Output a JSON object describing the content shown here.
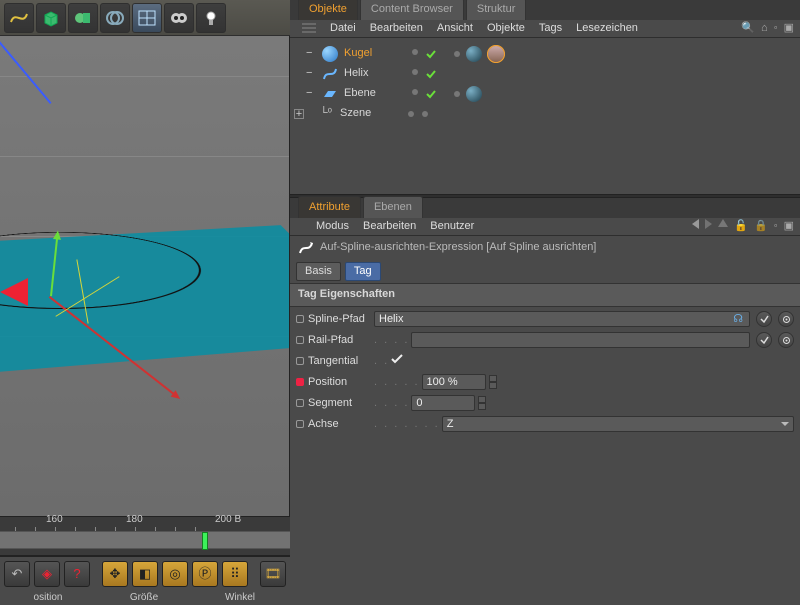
{
  "toolbar_icons": [
    "spline-icon",
    "cube-icon",
    "primitive-icon",
    "boole-icon",
    "plane-icon",
    "camera-icon",
    "light-icon"
  ],
  "object_tabs": {
    "objekte": "Objekte",
    "content_browser": "Content Browser",
    "struktur": "Struktur"
  },
  "object_menu": [
    "Datei",
    "Bearbeiten",
    "Ansicht",
    "Objekte",
    "Tags",
    "Lesezeichen"
  ],
  "hierarchy": [
    {
      "name": "Kugel",
      "type": "sphere",
      "selected": true,
      "tags": 2,
      "tagshape": "align",
      "checks": true
    },
    {
      "name": "Helix",
      "type": "helix",
      "checks": true
    },
    {
      "name": "Ebene",
      "type": "plane",
      "tags": 2,
      "checks": true
    },
    {
      "name": "Szene",
      "type": "scene",
      "expand": true
    }
  ],
  "attr_tabs": {
    "attribute": "Attribute",
    "ebenen": "Ebenen"
  },
  "attr_menu": [
    "Modus",
    "Bearbeiten",
    "Benutzer"
  ],
  "expression_title": "Auf-Spline-ausrichten-Expression [Auf Spline ausrichten]",
  "basis": "Basis",
  "tag": "Tag",
  "section": "Tag Eigenschaften",
  "props": {
    "spline_pfad": {
      "label": "Spline-Pfad",
      "value": "Helix"
    },
    "rail_pfad": {
      "label": "Rail-Pfad",
      "value": ""
    },
    "tangential": {
      "label": "Tangential",
      "checked": true
    },
    "position": {
      "label": "Position",
      "value": "100 %"
    },
    "segment": {
      "label": "Segment",
      "value": "0"
    },
    "achse": {
      "label": "Achse",
      "value": "Z"
    }
  },
  "timeline": {
    "t1": "160",
    "t2": "180",
    "t3": "200 B",
    "marker_pct": 76
  },
  "footer": {
    "pos": "osition",
    "groesse": "Größe",
    "winkel": "Winkel"
  }
}
